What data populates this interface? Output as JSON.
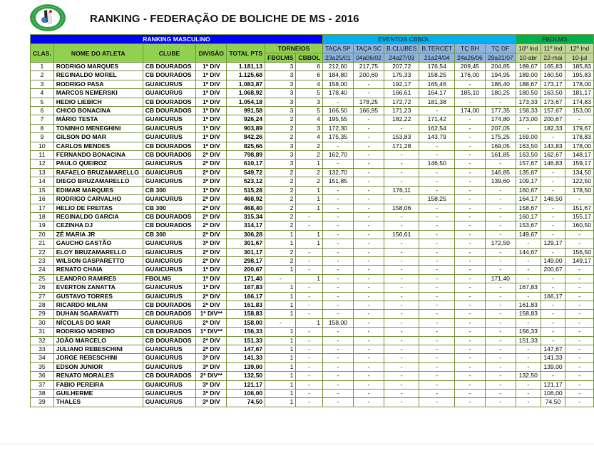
{
  "title": "RANKING - FEDERAÇÃO DE BOLICHE DE MS - 2016",
  "logo": {
    "icon": "federation-logo-icon",
    "ring_color": "#2e9e44"
  },
  "colors": {
    "border": "#76923c",
    "ranking_header": "#0000ff",
    "eventos_cbbol_header": "#00b0f0",
    "fbolms_header": "#00b050",
    "green_header": "#92d050",
    "event_cols": "#8db3e2",
    "fbolms_cols": "#c4d79b"
  },
  "headers": {
    "ranking": "RANKING MASCULINO",
    "eventos_cbbol": "EVENTOS CBBOL",
    "fbolms": "FBOLMS",
    "clas": "CLAS.",
    "nome": "NOME DO ATLETA",
    "clube": "CLUBE",
    "divisao": "DIVISÃO",
    "total": "TOTAL PTS",
    "torneios": "TORNEIOS",
    "torneios_fbolms": "FBOLMS",
    "torneios_cbbol": "CBBOL",
    "events": [
      {
        "name": "TAÇA SP",
        "date": "23a25/01"
      },
      {
        "name": "TAÇA SC",
        "date": "04a06/02"
      },
      {
        "name": "B.CLUBES",
        "date": "24a27/03"
      },
      {
        "name": "B.TERCET",
        "date": "21a24/04"
      },
      {
        "name": "TÇ BH",
        "date": "24a26/06"
      },
      {
        "name": "TÇ DF",
        "date": "29a31/07"
      },
      {
        "name": "10º Ind",
        "date": "10-abr"
      },
      {
        "name": "11º Ind",
        "date": "22-mai"
      },
      {
        "name": "12º Ind",
        "date": "10-jul"
      }
    ]
  },
  "rows": [
    {
      "clas": "1",
      "nome": "RODRIGO MARQUES",
      "clube": "CB DOURADOS",
      "div": "1ª DIV",
      "total": "1.181,13",
      "tf": "3",
      "tc": "6",
      "e": [
        "212,60",
        "217,75",
        "207,72",
        "176,54",
        "209,45",
        "204,85",
        "189,67",
        "165,83",
        "185,83"
      ]
    },
    {
      "clas": "2",
      "nome": "REGINALDO MOREL",
      "clube": "CB DOURADOS",
      "div": "1ª DIV",
      "total": "1.125,68",
      "tf": "3",
      "tc": "6",
      "e": [
        "184,80",
        "200,60",
        "175,33",
        "158,25",
        "176,00",
        "194,95",
        "189,00",
        "160,50",
        "195,83"
      ]
    },
    {
      "clas": "3",
      "nome": "RODRIGO PASA",
      "clube": "GUAICURUS",
      "div": "1ª DIV",
      "total": "1.083,87",
      "tf": "3",
      "tc": "4",
      "e": [
        "158,00",
        "-",
        "192,17",
        "165,46",
        "-",
        "186,40",
        "188,67",
        "173,17",
        "178,00"
      ]
    },
    {
      "clas": "4",
      "nome": "MARCOS NEMERSKI",
      "clube": "GUAICURUS",
      "div": "1ª DIV",
      "total": "1.068,92",
      "tf": "3",
      "tc": "5",
      "e": [
        "178,40",
        "-",
        "166,61",
        "164,17",
        "185,10",
        "180,25",
        "180,50",
        "163,50",
        "181,17"
      ]
    },
    {
      "clas": "5",
      "nome": "HEDIO LIEBICH",
      "clube": "CB DOURADOS",
      "div": "1ª DIV",
      "total": "1.054,18",
      "tf": "3",
      "tc": "3",
      "e": [
        "-",
        "178,25",
        "172,72",
        "181,38",
        "-",
        "-",
        "173,33",
        "173,67",
        "174,83"
      ]
    },
    {
      "clas": "6",
      "nome": "CHICO BONACINA",
      "clube": "CB DOURADOS",
      "div": "1ª DIV",
      "total": "991,58",
      "tf": "3",
      "tc": "5",
      "e": [
        "166,50",
        "166,95",
        "171,23",
        "-",
        "174,00",
        "177,35",
        "158,33",
        "157,67",
        "153,00"
      ]
    },
    {
      "clas": "7",
      "nome": "MÁRIO TESTA",
      "clube": "GUAICURUS",
      "div": "1ª DIV",
      "total": "926,24",
      "tf": "2",
      "tc": "4",
      "e": [
        "195,55",
        "-",
        "182,22",
        "171,42",
        "-",
        "174,80",
        "173,00",
        "200,67",
        "-"
      ]
    },
    {
      "clas": "8",
      "nome": "TONINHO MENEGHINI",
      "clube": "GUAICURUS",
      "div": "1ª DIV",
      "total": "903,89",
      "tf": "2",
      "tc": "3",
      "e": [
        "172,30",
        "-",
        "-",
        "162,54",
        "-",
        "207,05",
        "-",
        "182,33",
        "179,67"
      ]
    },
    {
      "clas": "9",
      "nome": "GILSON DO MAR",
      "clube": "GUAICURUS",
      "div": "1ª DIV",
      "total": "842,26",
      "tf": "2",
      "tc": "4",
      "e": [
        "175,35",
        "-",
        "153,83",
        "143,79",
        "-",
        "175,25",
        "159,00",
        "-",
        "178,83"
      ]
    },
    {
      "clas": "10",
      "nome": "CARLOS MENDES",
      "clube": "CB DOURADOS",
      "div": "1ª DIV",
      "total": "825,66",
      "tf": "3",
      "tc": "2",
      "e": [
        "-",
        "-",
        "171,28",
        "-",
        "-",
        "169,05",
        "163,50",
        "143,83",
        "178,00"
      ]
    },
    {
      "clas": "11",
      "nome": "FERNANDO BONACINA",
      "clube": "CB DOURADOS",
      "div": "2ª DIV",
      "total": "798,89",
      "tf": "3",
      "tc": "2",
      "e": [
        "162,70",
        "-",
        "-",
        "-",
        "-",
        "161,85",
        "163,50",
        "162,67",
        "148,17"
      ]
    },
    {
      "clas": "12",
      "nome": "PAULO QUEIROZ",
      "clube": "GUAICURUS",
      "div": "2ª DIV",
      "total": "610,17",
      "tf": "3",
      "tc": "1",
      "e": [
        "-",
        "-",
        "-",
        "146,50",
        "-",
        "-",
        "157,67",
        "146,83",
        "159,17"
      ]
    },
    {
      "clas": "13",
      "nome": "RAFAELO BRUZAMARELLO",
      "clube": "GUAICURUS",
      "div": "2ª DIV",
      "total": "549,72",
      "tf": "2",
      "tc": "2",
      "e": [
        "132,70",
        "-",
        "-",
        "-",
        "-",
        "146,85",
        "135,67",
        "-",
        "134,50"
      ]
    },
    {
      "clas": "14",
      "nome": "DIEGO BRUZAMARELLO",
      "clube": "GUAICURUS",
      "div": "3ª DIV",
      "total": "523,12",
      "tf": "2",
      "tc": "2",
      "e": [
        "151,85",
        "-",
        "-",
        "-",
        "-",
        "139,60",
        "109,17",
        "-",
        "122,50"
      ]
    },
    {
      "clas": "15",
      "nome": "EDIMAR MARQUES",
      "clube": "CB 300",
      "div": "1ª DIV",
      "total": "515,28",
      "tf": "2",
      "tc": "1",
      "e": [
        "-",
        "-",
        "176,11",
        "-",
        "-",
        "-",
        "160,67",
        "-",
        "178,50"
      ]
    },
    {
      "clas": "16",
      "nome": "RODRIGO CARVALHO",
      "clube": "GUAICURUS",
      "div": "2ª DIV",
      "total": "468,92",
      "tf": "2",
      "tc": "1",
      "e": [
        "-",
        "-",
        "-",
        "158,25",
        "-",
        "-",
        "164,17",
        "146,50",
        "-"
      ]
    },
    {
      "clas": "17",
      "nome": "HELIO DE FREITAS",
      "clube": "CB 300",
      "div": "2ª DIV",
      "total": "468,40",
      "tf": "2",
      "tc": "1",
      "e": [
        "-",
        "-",
        "158,06",
        "-",
        "-",
        "-",
        "158,67",
        "-",
        "151,67"
      ]
    },
    {
      "clas": "18",
      "nome": "REGINALDO GARCIA",
      "clube": "CB DOURADOS",
      "div": "2ª DIV",
      "total": "315,34",
      "tf": "2",
      "tc": "-",
      "e": [
        "-",
        "-",
        "-",
        "-",
        "-",
        "-",
        "160,17",
        "-",
        "155,17"
      ]
    },
    {
      "clas": "19",
      "nome": "CEZINHA DJ",
      "clube": "CB DOURADOS",
      "div": "2ª DIV",
      "total": "314,17",
      "tf": "2",
      "tc": "-",
      "e": [
        "-",
        "-",
        "-",
        "-",
        "-",
        "-",
        "153,67",
        "-",
        "160,50"
      ]
    },
    {
      "clas": "20",
      "nome": "ZÉ MARIA JR",
      "clube": "CB 300",
      "div": "2ª DIV",
      "total": "306,28",
      "tf": "1",
      "tc": "1",
      "e": [
        "-",
        "-",
        "156,61",
        "-",
        "-",
        "-",
        "149,67",
        "-",
        "-"
      ]
    },
    {
      "clas": "21",
      "nome": "GAUCHO GASTÃO",
      "clube": "GUAICURUS",
      "div": "3ª DIV",
      "total": "301,67",
      "tf": "1",
      "tc": "1",
      "e": [
        "-",
        "-",
        "-",
        "-",
        "-",
        "172,50",
        "-",
        "129,17",
        "-"
      ]
    },
    {
      "clas": "22",
      "nome": "ELOY BRUZAMARELLO",
      "clube": "GUAICURUS",
      "div": "2ª DIV",
      "total": "301,17",
      "tf": "2",
      "tc": "-",
      "e": [
        "-",
        "-",
        "-",
        "-",
        "-",
        "-",
        "144,67",
        "-",
        "156,50"
      ]
    },
    {
      "clas": "23",
      "nome": "WILSON GASPARETTO",
      "clube": "GUAICURUS",
      "div": "2ª DIV",
      "total": "298,17",
      "tf": "2",
      "tc": "-",
      "e": [
        "-",
        "-",
        "-",
        "-",
        "-",
        "-",
        "-",
        "149,00",
        "149,17"
      ]
    },
    {
      "clas": "24",
      "nome": "RENATO CHAIA",
      "clube": "GUAICURUS",
      "div": "1ª DIV",
      "total": "200,67",
      "tf": "1",
      "tc": "-",
      "e": [
        "-",
        "-",
        "-",
        "-",
        "-",
        "-",
        "-",
        "200,67",
        "-"
      ]
    },
    {
      "clas": "25",
      "nome": "LEANDRO RAMIRES",
      "clube": "FBOLMS",
      "div": "1ª DIV",
      "total": "171,40",
      "tf": "-",
      "tc": "1",
      "e": [
        "-",
        "-",
        "-",
        "-",
        "-",
        "171,40",
        "-",
        "-",
        "-"
      ]
    },
    {
      "clas": "26",
      "nome": "EVERTON ZANATTA",
      "clube": "GUAICURUS",
      "div": "1ª DIV",
      "total": "167,83",
      "tf": "1",
      "tc": "-",
      "e": [
        "-",
        "-",
        "-",
        "-",
        "-",
        "-",
        "167,83",
        "-",
        "-"
      ]
    },
    {
      "clas": "27",
      "nome": "GUSTAVO TORRES",
      "clube": "GUAICURUS",
      "div": "2ª DIV",
      "total": "166,17",
      "tf": "1",
      "tc": "-",
      "e": [
        "-",
        "-",
        "-",
        "-",
        "-",
        "-",
        "-",
        "166,17",
        "-"
      ]
    },
    {
      "clas": "28",
      "nome": "RICARDO MILANI",
      "clube": "CB DOURADOS",
      "div": "2ª DIV",
      "total": "161,83",
      "tf": "1",
      "tc": "-",
      "e": [
        "-",
        "-",
        "-",
        "-",
        "-",
        "-",
        "161,83",
        "-",
        "-"
      ]
    },
    {
      "clas": "29",
      "nome": "DUHAN SGARAVATTI",
      "clube": "CB DOURADOS",
      "div": "1ª DIV**",
      "total": "158,83",
      "tf": "1",
      "tc": "-",
      "e": [
        "-",
        "-",
        "-",
        "-",
        "-",
        "-",
        "158,83",
        "-",
        "-"
      ]
    },
    {
      "clas": "30",
      "nome": "NÍCOLAS DO MAR",
      "clube": "GUAICURUS",
      "div": "2ª DIV",
      "total": "158,00",
      "tf": "-",
      "tc": "1",
      "e": [
        "158,00",
        "-",
        "-",
        "-",
        "-",
        "-",
        "-",
        "-",
        "-"
      ]
    },
    {
      "clas": "31",
      "nome": "RODRIGO MORENO",
      "clube": "CB DOURADOS",
      "div": "1ª DIV**",
      "total": "156,33",
      "tf": "1",
      "tc": "-",
      "e": [
        "-",
        "-",
        "-",
        "-",
        "-",
        "-",
        "156,33",
        "-",
        "-"
      ]
    },
    {
      "clas": "32",
      "nome": "JOÃO MARCELO",
      "clube": "CB DOURADOS",
      "div": "2ª DIV",
      "total": "151,33",
      "tf": "1",
      "tc": "-",
      "e": [
        "-",
        "-",
        "-",
        "-",
        "-",
        "-",
        "151,33",
        "-",
        "-"
      ]
    },
    {
      "clas": "33",
      "nome": "JULIANO REBESCHINI",
      "clube": "GUAICURUS",
      "div": "2ª DIV",
      "total": "147,67",
      "tf": "1",
      "tc": "-",
      "e": [
        "-",
        "-",
        "-",
        "-",
        "-",
        "-",
        "-",
        "147,67",
        "-"
      ]
    },
    {
      "clas": "34",
      "nome": "JORGE REBESCHINI",
      "clube": "GUAICURUS",
      "div": "3ª DIV",
      "total": "141,33",
      "tf": "1",
      "tc": "-",
      "e": [
        "-",
        "-",
        "-",
        "-",
        "-",
        "-",
        "-",
        "141,33",
        "-"
      ]
    },
    {
      "clas": "35",
      "nome": "EDSON JUNIOR",
      "clube": "GUAICURUS",
      "div": "3ª DIV",
      "total": "139,00",
      "tf": "1",
      "tc": "-",
      "e": [
        "-",
        "-",
        "-",
        "-",
        "-",
        "-",
        "-",
        "139,00",
        "-"
      ]
    },
    {
      "clas": "36",
      "nome": "RENATO MORALES",
      "clube": "CB DOURADOS",
      "div": "2ª DIV**",
      "total": "132,50",
      "tf": "1",
      "tc": "-",
      "e": [
        "-",
        "-",
        "-",
        "-",
        "-",
        "-",
        "132,50",
        "-",
        "-"
      ]
    },
    {
      "clas": "37",
      "nome": "FABIO PEREIRA",
      "clube": "GUAICURUS",
      "div": "3ª DIV",
      "total": "121,17",
      "tf": "1",
      "tc": "-",
      "e": [
        "-",
        "-",
        "-",
        "-",
        "-",
        "-",
        "-",
        "121,17",
        "-"
      ]
    },
    {
      "clas": "38",
      "nome": "GUILHERME",
      "clube": "GUAICURUS",
      "div": "3ª DIV",
      "total": "106,00",
      "tf": "1",
      "tc": "-",
      "e": [
        "-",
        "-",
        "-",
        "-",
        "-",
        "-",
        "-",
        "106,00",
        "-"
      ]
    },
    {
      "clas": "39",
      "nome": "THALES",
      "clube": "GUAICURUS",
      "div": "3ª DIV",
      "total": "74,50",
      "tf": "1",
      "tc": "-",
      "e": [
        "-",
        "-",
        "-",
        "-",
        "-",
        "-",
        "-",
        "74,50",
        "-"
      ]
    }
  ]
}
